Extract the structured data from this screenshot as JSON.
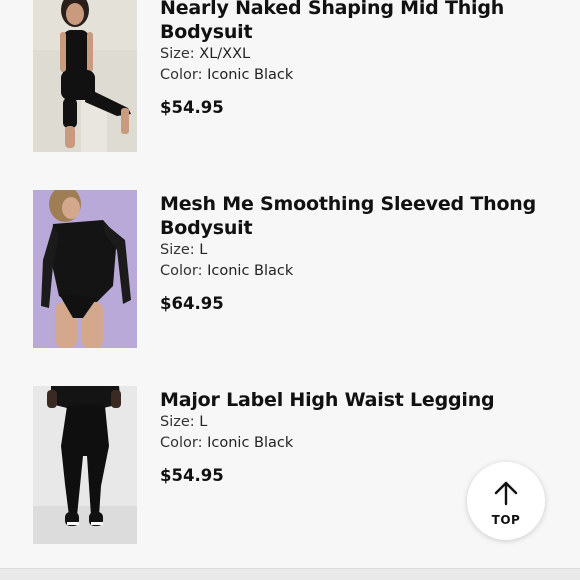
{
  "products": [
    {
      "name": "Nearly Naked Shaping Mid Thigh Bodysuit",
      "size_label": "Size:",
      "size": "XL/XXL",
      "color_label": "Color:",
      "color": "Iconic Black",
      "price": "$54.95"
    },
    {
      "name": "Mesh Me Smoothing Sleeved Thong Bodysuit",
      "size_label": "Size:",
      "size": "L",
      "color_label": "Color:",
      "color": "Iconic Black",
      "price": "$64.95"
    },
    {
      "name": "Major Label High Waist Legging",
      "size_label": "Size:",
      "size": "L",
      "color_label": "Color:",
      "color": "Iconic Black",
      "price": "$54.95"
    }
  ],
  "top_button": {
    "label": "TOP",
    "icon": "arrow-up-icon"
  },
  "colors": {
    "background": "#f7f7f7",
    "text": "#111111",
    "thumb1_bg": "#d9d6cc",
    "thumb2_bg": "#b6a7d6",
    "thumb3_bg": "#e6e6e6"
  }
}
